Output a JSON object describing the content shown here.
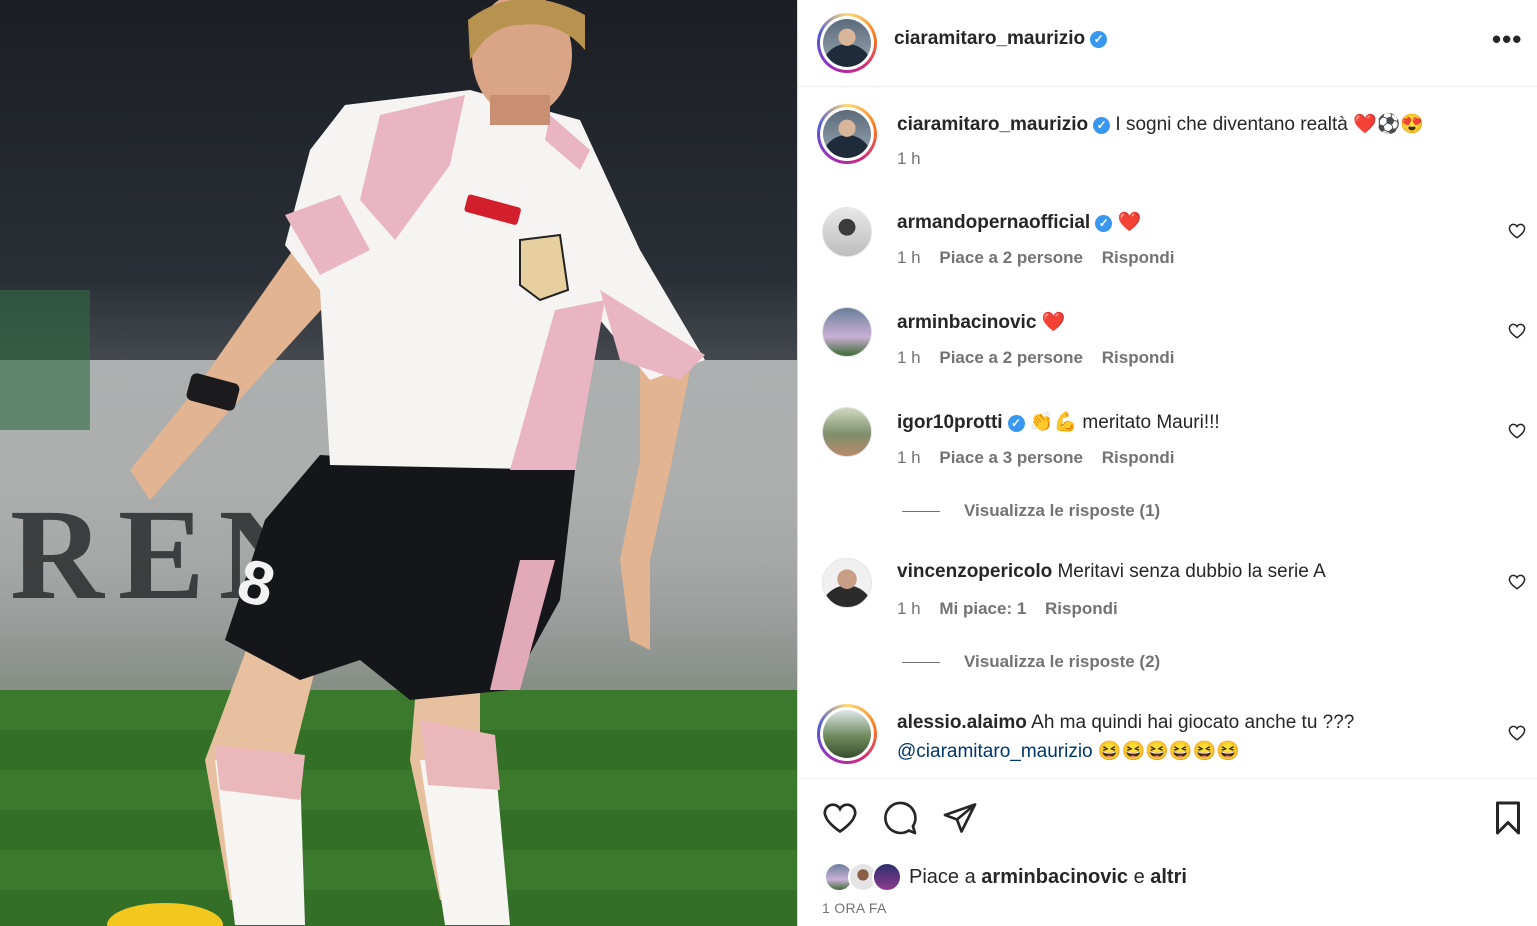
{
  "post": {
    "author": "ciaramitaro_maurizio",
    "verified_mark": "✓",
    "more_icon": "•••",
    "caption": {
      "username": "ciaramitaro_maurizio",
      "text": "I sogni che diventano realtà ❤️⚽😍",
      "time": "1 h"
    },
    "photo": {
      "banner_text": "REN     T"
    }
  },
  "comments": [
    {
      "username": "armandopernaofficial",
      "verified": true,
      "text": "❤️",
      "time": "1 h",
      "likes": "Piace a 2 persone",
      "reply": "Rispondi"
    },
    {
      "username": "arminbacinovic",
      "verified": false,
      "text": "❤️",
      "time": "1 h",
      "likes": "Piace a 2 persone",
      "reply": "Rispondi"
    },
    {
      "username": "igor10protti",
      "verified": true,
      "text": "👏💪  meritato Mauri!!!",
      "time": "1 h",
      "likes": "Piace a 3 persone",
      "reply": "Rispondi",
      "view_replies": "Visualizza le risposte (1)"
    },
    {
      "username": "vincenzopericolo",
      "verified": false,
      "text": "Meritavi senza dubbio la serie A",
      "time": "1 h",
      "likes": "Mi piace: 1",
      "reply": "Rispondi",
      "view_replies": "Visualizza le risposte (2)"
    },
    {
      "username": "alessio.alaimo",
      "verified": false,
      "text": "Ah ma quindi hai giocato anche tu ???",
      "mention": "@ciaramitaro_maurizio",
      "text2": "😆😆😆😆😆😆"
    }
  ],
  "footer": {
    "likes_prefix": "Piace a",
    "likes_user": "arminbacinovic",
    "likes_joiner": "e",
    "likes_others": "altri",
    "time": "1 ORA FA"
  },
  "icons": [
    "heart-icon",
    "comment-icon",
    "share-icon",
    "bookmark-icon",
    "more-icon",
    "verified-icon"
  ]
}
